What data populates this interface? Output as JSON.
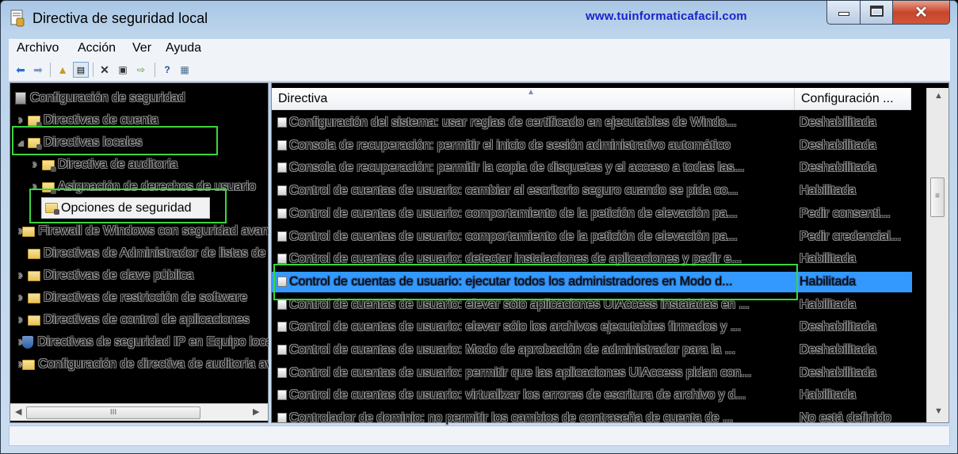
{
  "window": {
    "title": "Directiva de seguridad local",
    "watermark": "www.tuinformaticafacil.com",
    "close_symbol": "✕"
  },
  "menu": {
    "items": [
      "Archivo",
      "Acción",
      "Ver",
      "Ayuda"
    ]
  },
  "toolbar": {
    "buttons": [
      "back-arrow-icon",
      "forward-arrow-icon",
      "up-folder-icon",
      "show-hide-tree-icon",
      "delete-icon",
      "properties-icon",
      "export-list-icon",
      "help-icon",
      "extended-view-icon"
    ]
  },
  "tree": {
    "root": "Configuración de seguridad",
    "items": [
      {
        "label": "Directivas de cuenta",
        "expander": "›"
      },
      {
        "label": "Directivas locales",
        "expander": "◢"
      },
      {
        "label": "Directiva de auditoría",
        "expander": "›"
      },
      {
        "label": "Asignación de derechos de usuario",
        "expander": "›"
      },
      {
        "label": "Opciones de seguridad",
        "expander": ""
      },
      {
        "label": "Firewall de Windows con seguridad avanzada",
        "expander": "›"
      },
      {
        "label": "Directivas de Administrador de listas de redes",
        "expander": ""
      },
      {
        "label": "Directivas de clave pública",
        "expander": "›"
      },
      {
        "label": "Directivas de restricción de software",
        "expander": "›"
      },
      {
        "label": "Directivas de control de aplicaciones",
        "expander": "›"
      },
      {
        "label": "Directivas de seguridad IP en Equipo local",
        "expander": "›"
      },
      {
        "label": "Configuración de directiva de auditoría avanzada",
        "expander": "›"
      }
    ]
  },
  "list": {
    "columns": [
      "Directiva",
      "Configuración ..."
    ],
    "rows": [
      {
        "policy": "Configuración del sistema: usar reglas de certificado en ejecutables de Windo...",
        "setting": "Deshabilitada"
      },
      {
        "policy": "Consola de recuperación: permitir el inicio de sesión administrativo automático",
        "setting": "Deshabilitada"
      },
      {
        "policy": "Consola de recuperación: permitir la copia de disquetes y el acceso a todas las...",
        "setting": "Deshabilitada"
      },
      {
        "policy": "Control de cuentas de usuario: cambiar al escritorio seguro cuando se pida co...",
        "setting": "Habilitada"
      },
      {
        "policy": "Control de cuentas de usuario: comportamiento de la petición de elevación pa...",
        "setting": "Pedir consenti..."
      },
      {
        "policy": "Control de cuentas de usuario: comportamiento de la petición de elevación pa...",
        "setting": "Pedir credencial..."
      },
      {
        "policy": "Control de cuentas de usuario: detectar instalaciones de aplicaciones y pedir e...",
        "setting": "Habilitada"
      },
      {
        "policy": "Control de cuentas de usuario: ejecutar todos los administradores en Modo d...",
        "setting": "Habilitada"
      },
      {
        "policy": "Control de cuentas de usuario: elevar sólo aplicaciones UIAccess instaladas en ...",
        "setting": "Habilitada"
      },
      {
        "policy": "Control de cuentas de usuario: elevar sólo los archivos ejecutables firmados y ...",
        "setting": "Deshabilitada"
      },
      {
        "policy": "Control de cuentas de usuario: Modo de aprobación de administrador para la ...",
        "setting": "Deshabilitada"
      },
      {
        "policy": "Control de cuentas de usuario: permitir que las aplicaciones UIAccess pidan con...",
        "setting": "Deshabilitada"
      },
      {
        "policy": "Control de cuentas de usuario: virtualizar los errores de escritura de archivo y d...",
        "setting": "Habilitada"
      },
      {
        "policy": "Controlador de dominio: no permitir los cambios de contraseña de cuenta de ...",
        "setting": "No está definido"
      }
    ],
    "selected_index": 7
  },
  "scroll": {
    "grip": "III",
    "grip_v": "≡"
  },
  "colors": {
    "selection": "#3399ff",
    "highlight_box": "#3bd63b",
    "watermark": "#1a23c9"
  }
}
